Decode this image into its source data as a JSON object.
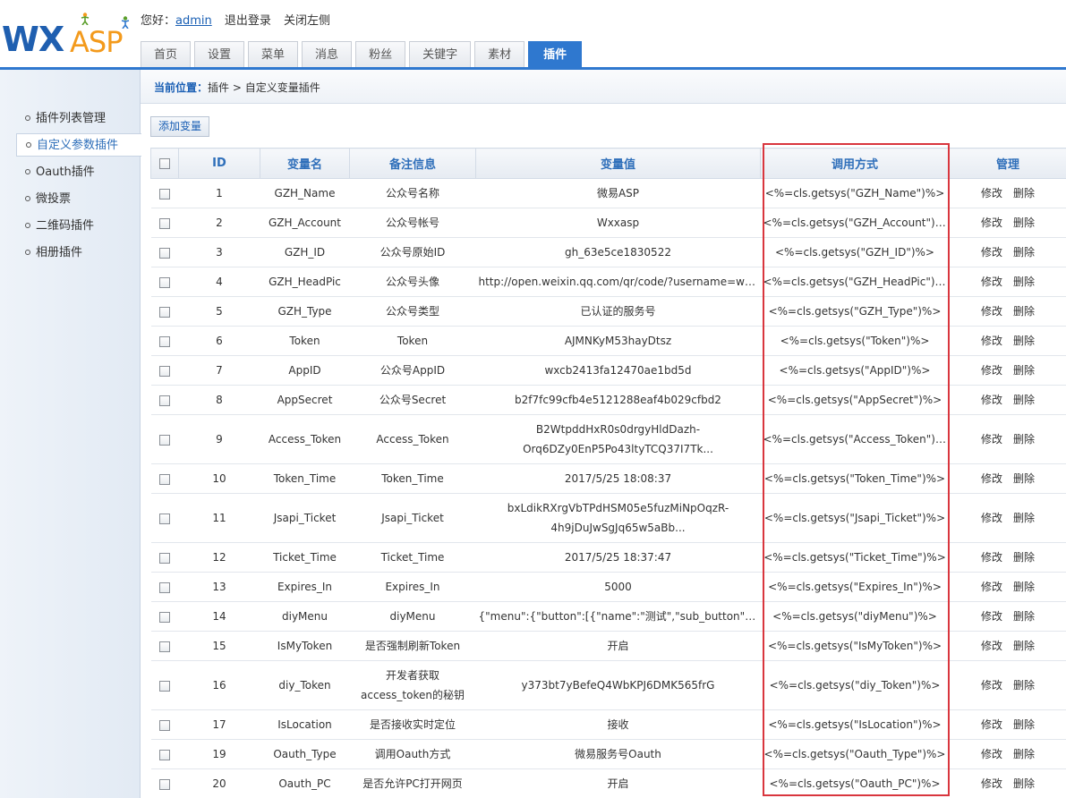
{
  "header": {
    "logo_wx": "WX",
    "logo_asp": "ASP",
    "greeting": "您好：",
    "username": "admin",
    "logout": "退出登录",
    "close_left": "关闭左侧"
  },
  "nav": {
    "tabs": [
      "首页",
      "设置",
      "菜单",
      "消息",
      "粉丝",
      "关键字",
      "素材",
      "插件"
    ],
    "active": "插件"
  },
  "sidebar": {
    "items": [
      "插件列表管理",
      "自定义参数插件",
      "Oauth插件",
      "微投票",
      "二维码插件",
      "相册插件"
    ],
    "active": "自定义参数插件"
  },
  "breadcrumb": {
    "label": "当前位置：",
    "path": "插件 > 自定义变量插件"
  },
  "toolbar": {
    "add_label": "添加变量"
  },
  "table": {
    "headers": [
      "ID",
      "变量名",
      "备注信息",
      "变量值",
      "调用方式",
      "管理"
    ],
    "edit_label": "修改",
    "delete_label": "删除",
    "rows": [
      {
        "id": "1",
        "name": "GZH_Name",
        "note": "公众号名称",
        "value": "微易ASP",
        "call": "<%=cls.getsys(\"GZH_Name\")%>"
      },
      {
        "id": "2",
        "name": "GZH_Account",
        "note": "公众号帐号",
        "value": "Wxxasp",
        "call": "<%=cls.getsys(\"GZH_Account\")%>"
      },
      {
        "id": "3",
        "name": "GZH_ID",
        "note": "公众号原始ID",
        "value": "gh_63e5ce1830522",
        "call": "<%=cls.getsys(\"GZH_ID\")%>"
      },
      {
        "id": "4",
        "name": "GZH_HeadPic",
        "note": "公众号头像",
        "value": "http://open.weixin.qq.com/qr/code/?username=wxxasp...",
        "call": "<%=cls.getsys(\"GZH_HeadPic\")%>"
      },
      {
        "id": "5",
        "name": "GZH_Type",
        "note": "公众号类型",
        "value": "已认证的服务号",
        "call": "<%=cls.getsys(\"GZH_Type\")%>"
      },
      {
        "id": "6",
        "name": "Token",
        "note": "Token",
        "value": "AJMNKyM53hayDtsz",
        "call": "<%=cls.getsys(\"Token\")%>"
      },
      {
        "id": "7",
        "name": "AppID",
        "note": "公众号AppID",
        "value": "wxcb2413fa12470ae1bd5d",
        "call": "<%=cls.getsys(\"AppID\")%>"
      },
      {
        "id": "8",
        "name": "AppSecret",
        "note": "公众号Secret",
        "value": "b2f7fc99cfb4e5121288eaf4b029cfbd2",
        "call": "<%=cls.getsys(\"AppSecret\")%>"
      },
      {
        "id": "9",
        "name": "Access_Token",
        "note": "Access_Token",
        "value": "B2WtpddHxR0s0drgyHldDazh-Orq6DZy0EnP5Po43ltyTCQ37I7Tk...",
        "call": "<%=cls.getsys(\"Access_Token\")%>"
      },
      {
        "id": "10",
        "name": "Token_Time",
        "note": "Token_Time",
        "value": "2017/5/25 18:08:37",
        "call": "<%=cls.getsys(\"Token_Time\")%>"
      },
      {
        "id": "11",
        "name": "Jsapi_Ticket",
        "note": "Jsapi_Ticket",
        "value": "bxLdikRXrgVbTPdHSM05e5fuzMiNpOqzR-4h9jDuJwSgJq65w5aBb...",
        "call": "<%=cls.getsys(\"Jsapi_Ticket\")%>"
      },
      {
        "id": "12",
        "name": "Ticket_Time",
        "note": "Ticket_Time",
        "value": "2017/5/25 18:37:47",
        "call": "<%=cls.getsys(\"Ticket_Time\")%>"
      },
      {
        "id": "13",
        "name": "Expires_In",
        "note": "Expires_In",
        "value": "5000",
        "call": "<%=cls.getsys(\"Expires_In\")%>"
      },
      {
        "id": "14",
        "name": "diyMenu",
        "note": "diyMenu",
        "value": "{\"menu\":{\"button\":[{\"name\":\"测试\",\"sub_button\":[{\"...",
        "call": "<%=cls.getsys(\"diyMenu\")%>"
      },
      {
        "id": "15",
        "name": "IsMyToken",
        "note": "是否强制刷新Token",
        "value": "开启",
        "call": "<%=cls.getsys(\"IsMyToken\")%>"
      },
      {
        "id": "16",
        "name": "diy_Token",
        "note": "开发者获取access_token的秘钥",
        "value": "y373bt7yBefeQ4WbKPJ6DMK565frG",
        "call": "<%=cls.getsys(\"diy_Token\")%>"
      },
      {
        "id": "17",
        "name": "IsLocation",
        "note": "是否接收实时定位",
        "value": "接收",
        "call": "<%=cls.getsys(\"IsLocation\")%>"
      },
      {
        "id": "19",
        "name": "Oauth_Type",
        "note": "调用Oauth方式",
        "value": "微易服务号Oauth",
        "call": "<%=cls.getsys(\"Oauth_Type\")%>"
      },
      {
        "id": "20",
        "name": "Oauth_PC",
        "note": "是否允许PC打开网页",
        "value": "开启",
        "call": "<%=cls.getsys(\"Oauth_PC\")%>"
      }
    ]
  },
  "colors": {
    "accent": "#2f78cf",
    "highlight": "#d9363e",
    "logo_blue": "#1f5fb0",
    "logo_orange": "#f39a1c"
  }
}
